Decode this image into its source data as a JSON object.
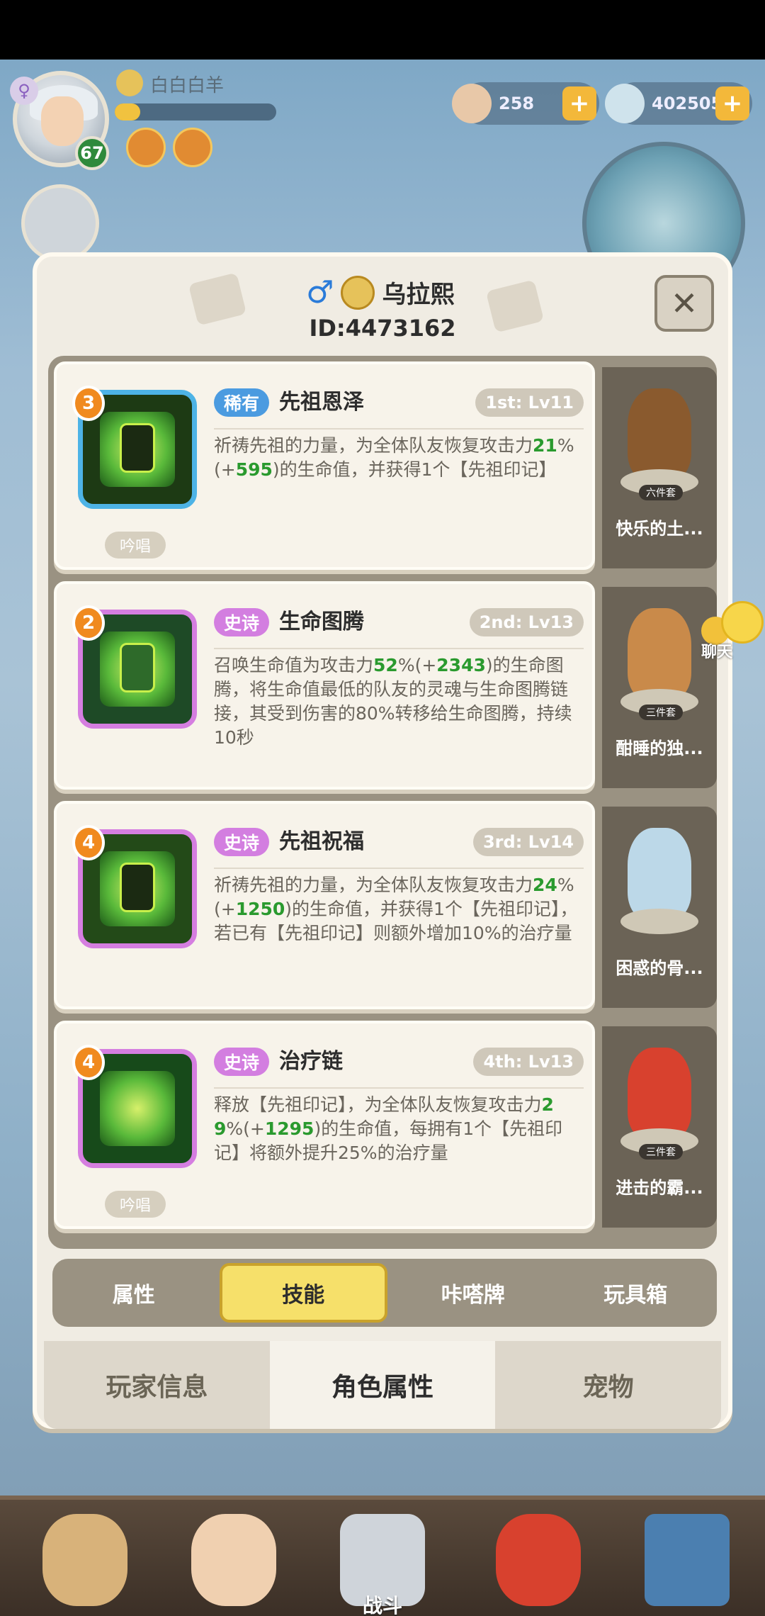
{
  "hud": {
    "player_name": "白白白羊",
    "level": "67",
    "exp_fraction": 0.16,
    "currency": [
      {
        "icon": "shell-icon",
        "value": "258"
      },
      {
        "icon": "pearl-icon",
        "value": "402505"
      }
    ]
  },
  "dialog": {
    "hero_name": "乌拉熙",
    "player_id": "ID:4473162",
    "close_label": "✕"
  },
  "skills": [
    {
      "order": "3",
      "rarity": "稀有",
      "rarity_type": "rare",
      "name": "先祖恩泽",
      "level": "1st: Lv11",
      "desc_parts": [
        "祈祷先祖的力量，为全体队友恢复攻击力",
        "21",
        "%(+",
        "595",
        ")的生命值，并获得1个【先祖印记】"
      ],
      "chant": "吟唱",
      "toy_name": "快乐的土...",
      "toy_set": "六件套",
      "toy_color": "#8a5a2e"
    },
    {
      "order": "2",
      "rarity": "史诗",
      "rarity_type": "epic",
      "name": "生命图腾",
      "level": "2nd: Lv13",
      "desc_parts": [
        "召唤生命值为攻击力",
        "52",
        "%(+",
        "2343",
        ")的生命图腾，将生命值最低的队友的灵魂与生命图腾链接，其受到伤害的80%转移给生命图腾，持续10秒"
      ],
      "chant": "",
      "toy_name": "酣睡的独...",
      "toy_set": "三件套",
      "toy_color": "#c98a4a"
    },
    {
      "order": "4",
      "rarity": "史诗",
      "rarity_type": "epic",
      "name": "先祖祝福",
      "level": "3rd: Lv14",
      "desc_parts": [
        "祈祷先祖的力量，为全体队友恢复攻击力",
        "24",
        "%(+",
        "1250",
        ")的生命值，并获得1个【先祖印记】，若已有【先祖印记】则额外增加10%的治疗量"
      ],
      "chant": "",
      "toy_name": "困惑的骨...",
      "toy_set": "",
      "toy_color": "#bcd8e8"
    },
    {
      "order": "4",
      "rarity": "史诗",
      "rarity_type": "epic",
      "name": "治疗链",
      "level": "4th: Lv13",
      "desc_parts": [
        "释放【先祖印记】，为全体队友恢复攻击力",
        "29",
        "%(+",
        "1295",
        ")的生命值，每拥有1个【先祖印记】将额外提升25%的治疗量"
      ],
      "chant": "吟唱",
      "toy_name": "进击的霸...",
      "toy_set": "三件套",
      "toy_color": "#d8412e"
    }
  ],
  "sub_tabs": [
    "属性",
    "技能",
    "咔嗒牌",
    "玩具箱"
  ],
  "active_sub_tab": 1,
  "main_tabs": [
    "玩家信息",
    "角色属性",
    "宠物"
  ],
  "active_main_tab": 1,
  "chat_label": "聊天",
  "bottom_nav": {
    "battle_label": "战斗"
  }
}
